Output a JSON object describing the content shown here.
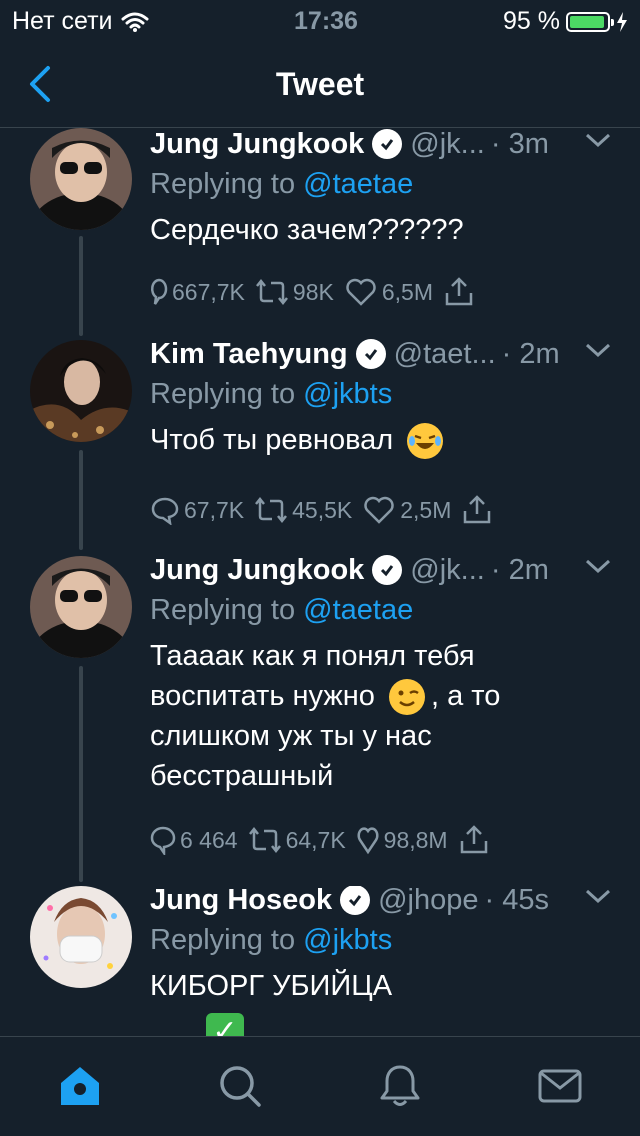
{
  "status": {
    "carrier": "Нет сети",
    "time": "17:36",
    "battery": "95 %",
    "battery_level": 0.95
  },
  "nav": {
    "title": "Tweet"
  },
  "tweets": [
    {
      "name": "Jung Jungkook",
      "handle": "@jk...",
      "time": "· 3m",
      "reply_prefix": "Replying to",
      "reply_to": "@taetae",
      "text": "Сердечко зачем??????",
      "replies": "667,7K",
      "retweets": "98K",
      "likes": "6,5M"
    },
    {
      "name": "Kim Taehyung",
      "handle": "@taet...",
      "time": "· 2m",
      "reply_prefix": "Replying to",
      "reply_to": "@jkbts",
      "text": "Чтоб ты ревновал",
      "replies": "67,7K",
      "retweets": "45,5K",
      "likes": "2,5M"
    },
    {
      "name": "Jung Jungkook",
      "handle": "@jk...",
      "time": "· 2m",
      "reply_prefix": "Replying to",
      "reply_to": "@taetae",
      "text_line1": "Таааак как я понял тебя",
      "text_line2a": "воспитать нужно",
      "text_line2b": ", а то",
      "text_line3": "слишком уж ты у нас",
      "text_line4": "бесстрашный",
      "replies": "6 464",
      "retweets": "64,7K",
      "likes": "98,8M"
    },
    {
      "name": "Jung Hoseok",
      "handle": "@jhope",
      "time": "· 45s",
      "reply_prefix": "Replying to",
      "reply_to": "@jkbts",
      "text": "КИБОРГ УБИЙЦА",
      "emoji_check": "✓"
    }
  ],
  "colors": {
    "background": "#15202b",
    "accent": "#1da1f2",
    "muted": "#8899a6",
    "divider": "#38444d"
  },
  "icons": [
    "wifi-icon",
    "back-chevron-icon",
    "verified-badge-icon",
    "caret-down-icon",
    "reply-icon",
    "retweet-icon",
    "like-icon",
    "share-icon",
    "home-icon",
    "search-icon",
    "notifications-icon",
    "messages-icon"
  ]
}
